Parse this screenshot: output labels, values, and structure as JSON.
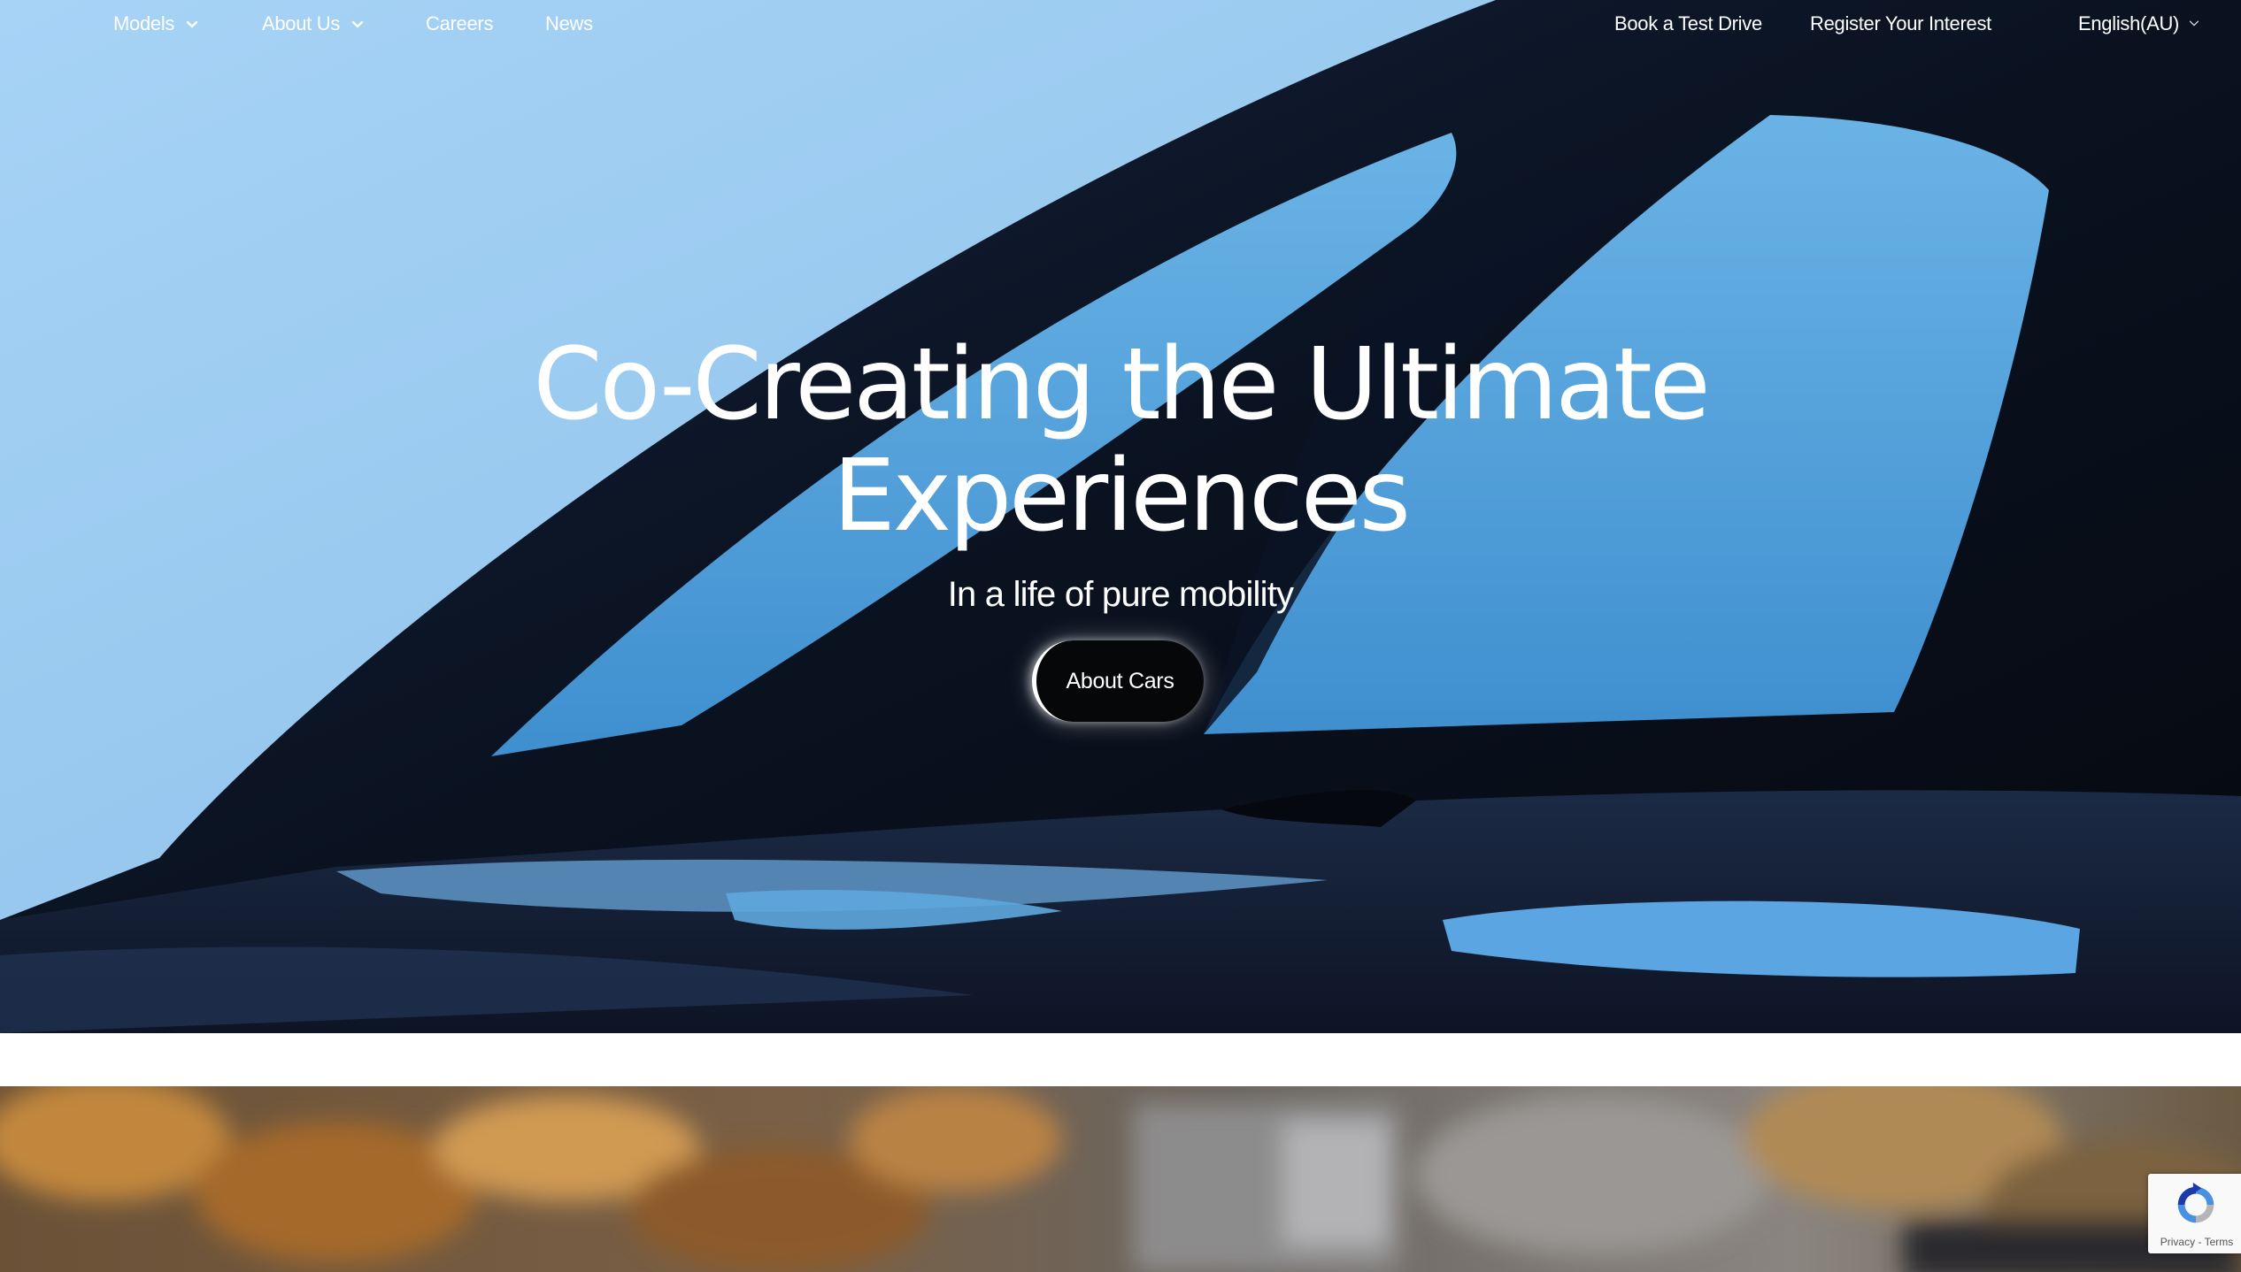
{
  "nav": {
    "left": [
      {
        "label": "Models",
        "has_dropdown": true
      },
      {
        "label": "About Us",
        "has_dropdown": true
      },
      {
        "label": "Careers",
        "has_dropdown": false
      },
      {
        "label": "News",
        "has_dropdown": false
      }
    ],
    "right": {
      "test_drive": "Book a Test Drive",
      "register": "Register Your Interest",
      "language": "English(AU)"
    }
  },
  "hero": {
    "headline_line1": "Co-Creating the Ultimate",
    "headline_line2": "Experiences",
    "subheadline": "In a life of pure mobility",
    "cta_label": "About Cars"
  },
  "recaptcha": {
    "privacy": "Privacy",
    "separator": "-",
    "terms": "Terms"
  },
  "colors": {
    "sky": "#9fcdf2",
    "car_body": "#0b1220",
    "window_glass": "#4f9fd6",
    "text": "#ffffff"
  },
  "icons": {
    "dropdown": "chevron-down-icon",
    "recaptcha": "recaptcha-logo-icon"
  }
}
